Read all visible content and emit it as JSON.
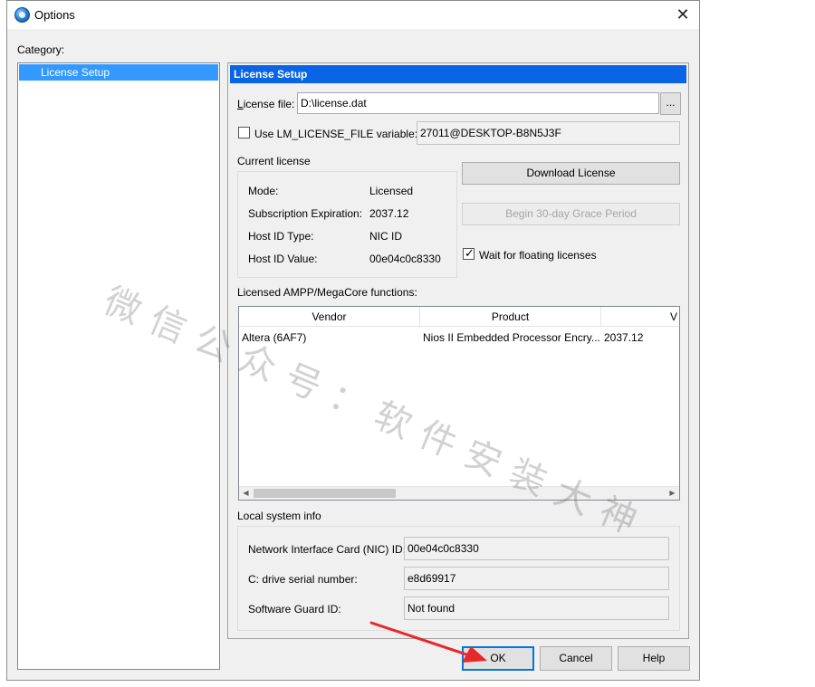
{
  "window": {
    "title": "Options",
    "close_glyph": "✕"
  },
  "category": {
    "label": "Category:",
    "items": [
      {
        "label": "License Setup",
        "selected": true
      }
    ]
  },
  "panel": {
    "header": "License Setup",
    "license_file": {
      "label_first": "L",
      "label_rest": "icense file:",
      "value": "D:\\license.dat",
      "browse_label": "..."
    },
    "lm_license": {
      "label": "Use LM_LICENSE_FILE variable:",
      "checked": false,
      "value": "27011@DESKTOP-B8N5J3F"
    },
    "current_license": {
      "title": "Current license",
      "rows": [
        {
          "label": "Mode:",
          "value": "Licensed"
        },
        {
          "label": "Subscription Expiration:",
          "value": "2037.12"
        },
        {
          "label": "Host ID Type:",
          "value": "NIC ID"
        },
        {
          "label": "Host ID Value:",
          "value": "00e04c0c8330"
        }
      ]
    },
    "download_button": "Download License",
    "grace_button": "Begin 30-day Grace Period",
    "wait_floating": {
      "label": "Wait for floating licenses",
      "checked": true
    },
    "functions": {
      "title": "Licensed AMPP/MegaCore functions:",
      "columns": [
        "Vendor",
        "Product",
        "V"
      ],
      "rows": [
        {
          "vendor": "Altera (6AF7)",
          "product": "Nios II Embedded Processor Encry...",
          "version": "2037.12"
        }
      ]
    },
    "local_info": {
      "title": "Local system info",
      "rows": [
        {
          "label": "Network Interface Card (NIC) ID:",
          "value": "00e04c0c8330"
        },
        {
          "label": "C: drive serial number:",
          "value": "e8d69917"
        },
        {
          "label": "Software Guard ID:",
          "value": "Not found"
        }
      ]
    }
  },
  "footer": {
    "ok": "OK",
    "cancel": "Cancel",
    "help": "Help"
  },
  "watermark": "微信公众号：软件安装大神",
  "colors": {
    "header_blue": "#0a64e6",
    "selection_blue": "#3399ff",
    "arrow_red": "#e8282a"
  }
}
